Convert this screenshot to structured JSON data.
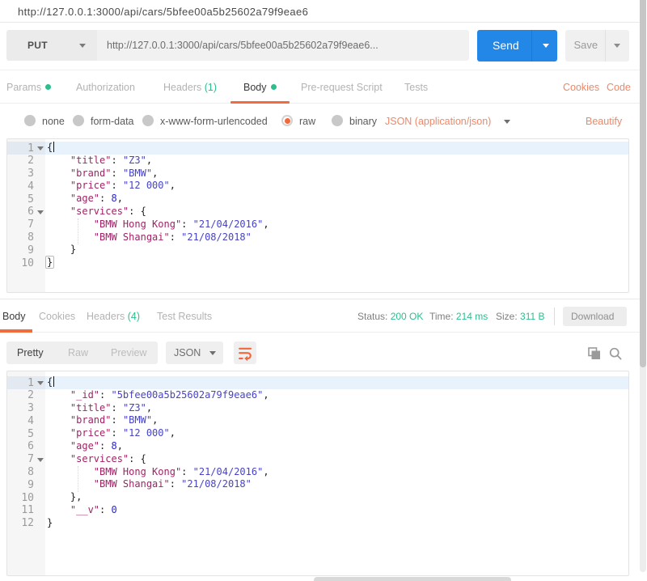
{
  "window": {
    "tab_title": "http://127.0.0.1:3000/api/cars/5bfee00a5b25602a79f9eae6"
  },
  "request": {
    "method": "PUT",
    "url": "http://127.0.0.1:3000/api/cars/5bfee00a5b25602a79f9eae6...",
    "send_label": "Send",
    "save_label": "Save",
    "tabs": [
      {
        "label": "Params",
        "dot": true,
        "active": false
      },
      {
        "label": "Authorization",
        "active": false
      },
      {
        "label": "Headers",
        "count": "(1)",
        "active": false
      },
      {
        "label": "Body",
        "dot": true,
        "active": true
      },
      {
        "label": "Pre-request Script",
        "active": false
      },
      {
        "label": "Tests",
        "active": false
      }
    ],
    "cookies_link": "Cookies",
    "code_link": "Code",
    "body_modes": [
      {
        "label": "none",
        "selected": false
      },
      {
        "label": "form-data",
        "selected": false
      },
      {
        "label": "x-www-form-urlencoded",
        "selected": false
      },
      {
        "label": "raw",
        "selected": true
      },
      {
        "label": "binary",
        "selected": false
      }
    ],
    "content_type": "JSON (application/json)",
    "beautify_label": "Beautify"
  },
  "request_editor": {
    "lines": [
      {
        "n": 1,
        "fold": true,
        "active": true,
        "cursor": true,
        "segs": [
          {
            "t": "{",
            "c": "p"
          }
        ]
      },
      {
        "n": 2,
        "segs": [
          {
            "t": "    ",
            "c": "p"
          },
          {
            "t": "\"title\"",
            "c": "k"
          },
          {
            "t": ": ",
            "c": "p"
          },
          {
            "t": "\"Z3\"",
            "c": "s"
          },
          {
            "t": ",",
            "c": "p"
          }
        ]
      },
      {
        "n": 3,
        "segs": [
          {
            "t": "    ",
            "c": "p"
          },
          {
            "t": "\"brand\"",
            "c": "k"
          },
          {
            "t": ": ",
            "c": "p"
          },
          {
            "t": "\"BMW\"",
            "c": "s"
          },
          {
            "t": ",",
            "c": "p"
          }
        ]
      },
      {
        "n": 4,
        "segs": [
          {
            "t": "    ",
            "c": "p"
          },
          {
            "t": "\"price\"",
            "c": "k"
          },
          {
            "t": ": ",
            "c": "p"
          },
          {
            "t": "\"12 000\"",
            "c": "s"
          },
          {
            "t": ",",
            "c": "p"
          }
        ]
      },
      {
        "n": 5,
        "segs": [
          {
            "t": "    ",
            "c": "p"
          },
          {
            "t": "\"age\"",
            "c": "k"
          },
          {
            "t": ": ",
            "c": "p"
          },
          {
            "t": "8",
            "c": "n"
          },
          {
            "t": ",",
            "c": "p"
          }
        ]
      },
      {
        "n": 6,
        "fold": true,
        "segs": [
          {
            "t": "    ",
            "c": "p"
          },
          {
            "t": "\"services\"",
            "c": "k"
          },
          {
            "t": ": ",
            "c": "p"
          },
          {
            "t": "{",
            "c": "p"
          }
        ]
      },
      {
        "n": 7,
        "segs": [
          {
            "t": "        ",
            "c": "p"
          },
          {
            "t": "\"BMW Hong Kong\"",
            "c": "k"
          },
          {
            "t": ": ",
            "c": "p"
          },
          {
            "t": "\"21/04/2016\"",
            "c": "s"
          },
          {
            "t": ",",
            "c": "p"
          }
        ]
      },
      {
        "n": 8,
        "segs": [
          {
            "t": "        ",
            "c": "p"
          },
          {
            "t": "\"BMW Shangai\"",
            "c": "k"
          },
          {
            "t": ": ",
            "c": "p"
          },
          {
            "t": "\"21/08/2018\"",
            "c": "s"
          }
        ]
      },
      {
        "n": 9,
        "segs": [
          {
            "t": "    ",
            "c": "p"
          },
          {
            "t": "}",
            "c": "p"
          }
        ]
      },
      {
        "n": 10,
        "segs": [
          {
            "t": "}",
            "c": "p bm"
          }
        ]
      }
    ]
  },
  "response": {
    "tabs": [
      {
        "label": "Body",
        "active": true
      },
      {
        "label": "Cookies",
        "active": false
      },
      {
        "label": "Headers",
        "count": "(4)",
        "active": false
      },
      {
        "label": "Test Results",
        "active": false
      }
    ],
    "meta": [
      {
        "label": "Status:",
        "value": "200 OK"
      },
      {
        "label": "Time:",
        "value": "214 ms"
      },
      {
        "label": "Size:",
        "value": "311 B"
      }
    ],
    "download_label": "Download",
    "view_modes": [
      {
        "label": "Pretty",
        "active": true
      },
      {
        "label": "Raw",
        "active": false
      },
      {
        "label": "Preview",
        "active": false
      }
    ],
    "format": "JSON"
  },
  "response_editor": {
    "lines": [
      {
        "n": 1,
        "fold": true,
        "active": true,
        "cursor": true,
        "segs": [
          {
            "t": "{",
            "c": "p"
          }
        ]
      },
      {
        "n": 2,
        "segs": [
          {
            "t": "    ",
            "c": "p"
          },
          {
            "t": "\"_id\"",
            "c": "k"
          },
          {
            "t": ": ",
            "c": "p"
          },
          {
            "t": "\"5bfee00a5b25602a79f9eae6\"",
            "c": "s"
          },
          {
            "t": ",",
            "c": "p"
          }
        ]
      },
      {
        "n": 3,
        "segs": [
          {
            "t": "    ",
            "c": "p"
          },
          {
            "t": "\"title\"",
            "c": "k"
          },
          {
            "t": ": ",
            "c": "p"
          },
          {
            "t": "\"Z3\"",
            "c": "s"
          },
          {
            "t": ",",
            "c": "p"
          }
        ]
      },
      {
        "n": 4,
        "segs": [
          {
            "t": "    ",
            "c": "p"
          },
          {
            "t": "\"brand\"",
            "c": "k"
          },
          {
            "t": ": ",
            "c": "p"
          },
          {
            "t": "\"BMW\"",
            "c": "s"
          },
          {
            "t": ",",
            "c": "p"
          }
        ]
      },
      {
        "n": 5,
        "segs": [
          {
            "t": "    ",
            "c": "p"
          },
          {
            "t": "\"price\"",
            "c": "k"
          },
          {
            "t": ": ",
            "c": "p"
          },
          {
            "t": "\"12 000\"",
            "c": "s"
          },
          {
            "t": ",",
            "c": "p"
          }
        ]
      },
      {
        "n": 6,
        "segs": [
          {
            "t": "    ",
            "c": "p"
          },
          {
            "t": "\"age\"",
            "c": "k"
          },
          {
            "t": ": ",
            "c": "p"
          },
          {
            "t": "8",
            "c": "n"
          },
          {
            "t": ",",
            "c": "p"
          }
        ]
      },
      {
        "n": 7,
        "fold": true,
        "segs": [
          {
            "t": "    ",
            "c": "p"
          },
          {
            "t": "\"services\"",
            "c": "k"
          },
          {
            "t": ": ",
            "c": "p"
          },
          {
            "t": "{",
            "c": "p"
          }
        ]
      },
      {
        "n": 8,
        "segs": [
          {
            "t": "        ",
            "c": "p"
          },
          {
            "t": "\"BMW Hong Kong\"",
            "c": "k"
          },
          {
            "t": ": ",
            "c": "p"
          },
          {
            "t": "\"21/04/2016\"",
            "c": "s"
          },
          {
            "t": ",",
            "c": "p"
          }
        ]
      },
      {
        "n": 9,
        "segs": [
          {
            "t": "        ",
            "c": "p"
          },
          {
            "t": "\"BMW Shangai\"",
            "c": "k"
          },
          {
            "t": ": ",
            "c": "p"
          },
          {
            "t": "\"21/08/2018\"",
            "c": "s"
          }
        ]
      },
      {
        "n": 10,
        "segs": [
          {
            "t": "    ",
            "c": "p"
          },
          {
            "t": "},",
            "c": "p"
          }
        ]
      },
      {
        "n": 11,
        "segs": [
          {
            "t": "    ",
            "c": "p"
          },
          {
            "t": "\"__v\"",
            "c": "k"
          },
          {
            "t": ": ",
            "c": "p"
          },
          {
            "t": "0",
            "c": "n"
          }
        ]
      },
      {
        "n": 12,
        "segs": [
          {
            "t": "}",
            "c": "p"
          }
        ]
      }
    ]
  },
  "colors": {
    "accent_orange": "#f26b3a",
    "link_orange": "#ef8768",
    "green": "#2dbe8d",
    "send_blue": "#2387e8",
    "json_key": "#9f2365",
    "json_string": "#4743c9",
    "json_number": "#2b23d5"
  },
  "icons": {
    "wrap_icon": "wrap-lines",
    "copy_icon": "copy",
    "search_icon": "search"
  }
}
